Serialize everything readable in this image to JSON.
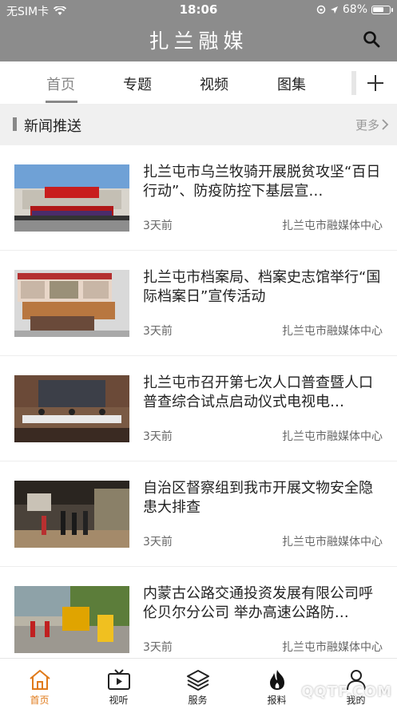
{
  "status_bar": {
    "carrier": "无SIM卡",
    "time": "18:06",
    "battery": "68%",
    "battery_level": 0.68
  },
  "header": {
    "title": "扎兰融媒"
  },
  "tabs": [
    {
      "label": "首页",
      "active": true
    },
    {
      "label": "专题",
      "active": false
    },
    {
      "label": "视频",
      "active": false
    },
    {
      "label": "图集",
      "active": false
    }
  ],
  "section": {
    "title": "新闻推送",
    "more": "更多"
  },
  "news": [
    {
      "title": "扎兰屯市乌兰牧骑开展脱贫攻坚“百日行动”、防疫防控下基层宣…",
      "time": "3天前",
      "source": "扎兰屯市融媒体中心"
    },
    {
      "title": "扎兰屯市档案局、档案史志馆举行“国际档案日”宣传活动",
      "time": "3天前",
      "source": "扎兰屯市融媒体中心"
    },
    {
      "title": "扎兰屯市召开第七次人口普查暨人口普查综合试点启动仪式电视电…",
      "time": "3天前",
      "source": "扎兰屯市融媒体中心"
    },
    {
      "title": "自治区督察组到我市开展文物安全隐患大排查",
      "time": "3天前",
      "source": "扎兰屯市融媒体中心"
    },
    {
      "title": "内蒙古公路交通投资发展有限公司呼伦贝尔分公司 举办高速公路防…",
      "time": "3天前",
      "source": "扎兰屯市融媒体中心"
    }
  ],
  "bottom_nav": [
    {
      "label": "首页",
      "icon": "home-icon",
      "active": true
    },
    {
      "label": "视听",
      "icon": "tv-icon",
      "active": false
    },
    {
      "label": "服务",
      "icon": "layers-icon",
      "active": false
    },
    {
      "label": "报料",
      "icon": "fire-icon",
      "active": false
    },
    {
      "label": "我的",
      "icon": "user-icon",
      "active": false
    }
  ],
  "watermark": "QQTF.COM",
  "colors": {
    "header_bg": "#8c8c8c",
    "accent": "#e07a1a",
    "section_bg": "#f0f0f0"
  }
}
